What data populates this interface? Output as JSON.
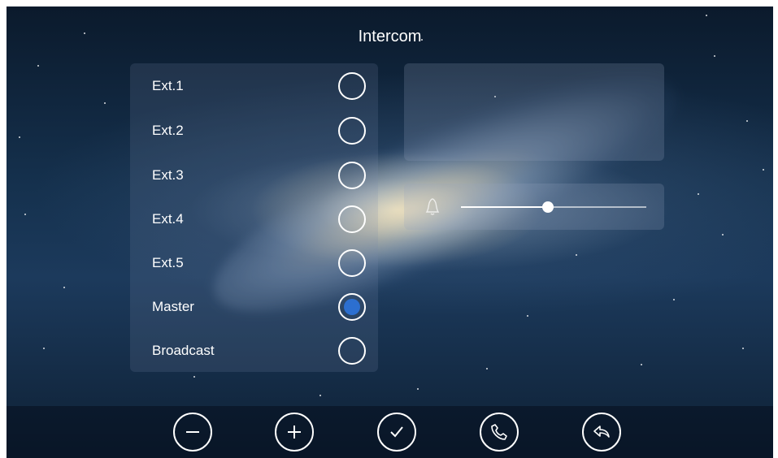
{
  "screen": {
    "title": "Intercom"
  },
  "extensions": [
    {
      "label": "Ext.1",
      "selected": false
    },
    {
      "label": "Ext.2",
      "selected": false
    },
    {
      "label": "Ext.3",
      "selected": false
    },
    {
      "label": "Ext.4",
      "selected": false
    },
    {
      "label": "Ext.5",
      "selected": false
    },
    {
      "label": "Master",
      "selected": true
    },
    {
      "label": "Broadcast",
      "selected": false
    }
  ],
  "volume": {
    "icon": "bell-icon",
    "level": 0.47
  },
  "toolbar": {
    "buttons": [
      {
        "icon": "minus-icon"
      },
      {
        "icon": "plus-icon"
      },
      {
        "icon": "check-icon"
      },
      {
        "icon": "phone-icon"
      },
      {
        "icon": "back-icon"
      }
    ]
  },
  "colors": {
    "accent": "#2c6fd0",
    "foreground": "#ffffff"
  }
}
